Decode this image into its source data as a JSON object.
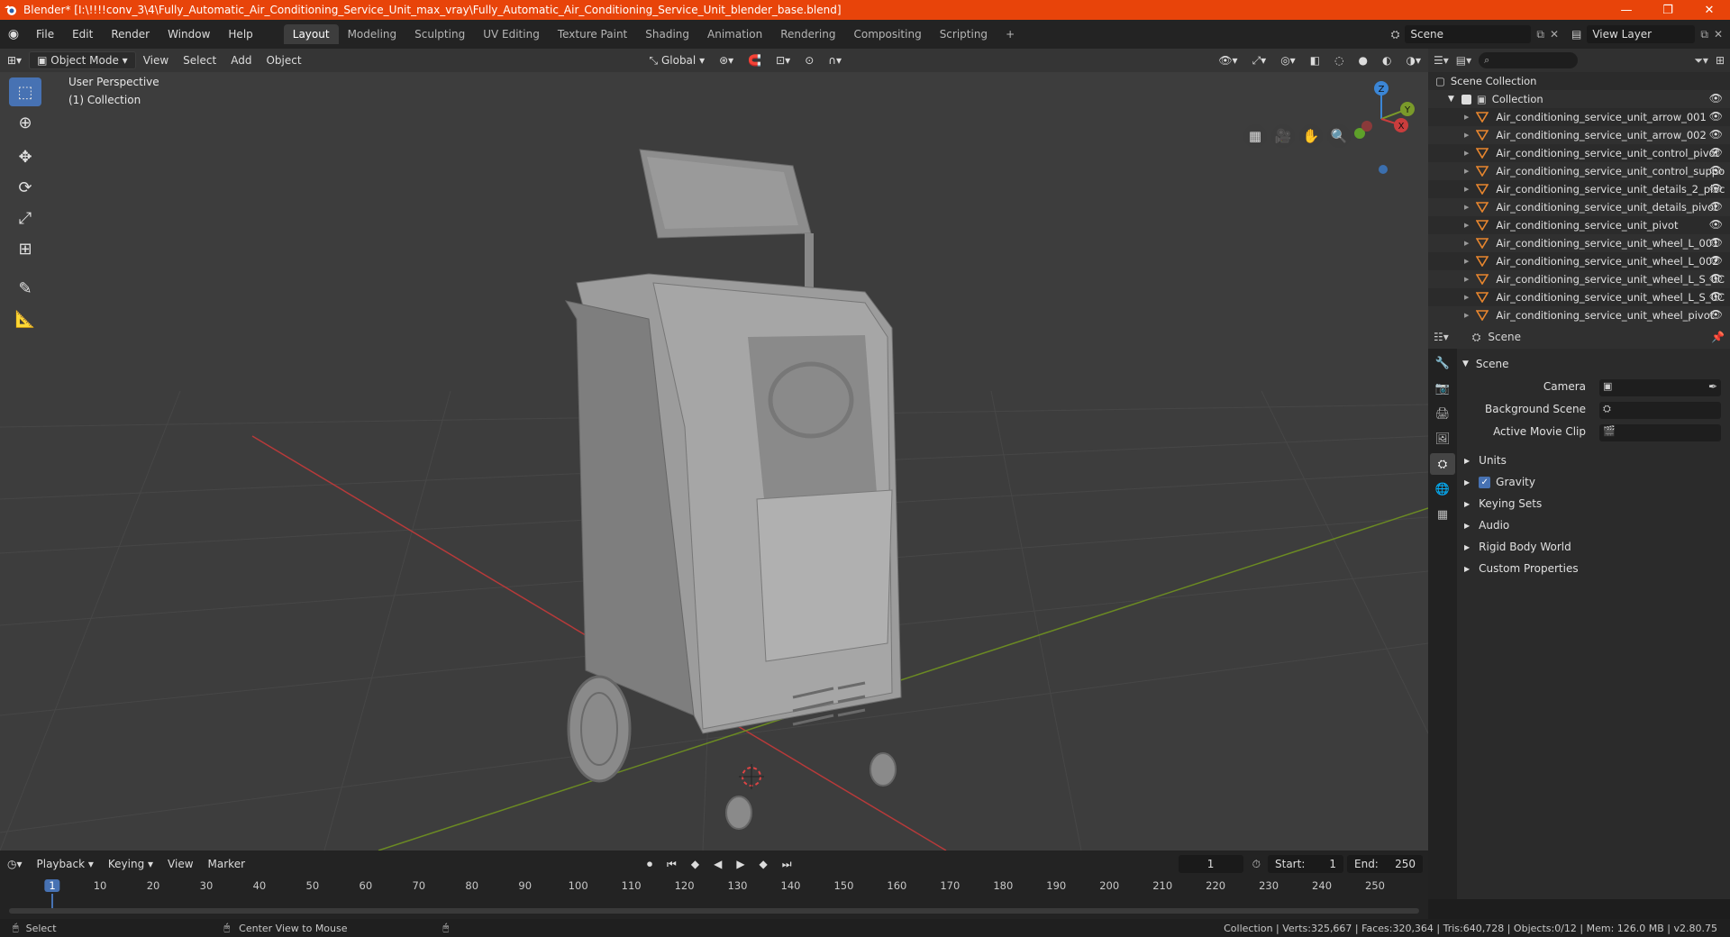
{
  "titlebar": {
    "title": "Blender* [I:\\!!!!conv_3\\4\\Fully_Automatic_Air_Conditioning_Service_Unit_max_vray\\Fully_Automatic_Air_Conditioning_Service_Unit_blender_base.blend]",
    "minimize": "—",
    "restore": "❐",
    "close": "✕"
  },
  "menu": {
    "items": [
      "File",
      "Edit",
      "Render",
      "Window",
      "Help"
    ],
    "workspaces": [
      "Layout",
      "Modeling",
      "Sculpting",
      "UV Editing",
      "Texture Paint",
      "Shading",
      "Animation",
      "Rendering",
      "Compositing",
      "Scripting"
    ],
    "active_workspace": "Layout",
    "add_workspace": "+",
    "scene_label": "Scene",
    "view_layer_label": "View Layer"
  },
  "viewport": {
    "mode": "Object Mode",
    "menus": [
      "View",
      "Select",
      "Add",
      "Object"
    ],
    "transform_orientation": "Global",
    "overlay_line1": "User Perspective",
    "overlay_line2": "(1) Collection",
    "gizmo_axes": {
      "z": "Z",
      "y": "Y",
      "x": "X"
    }
  },
  "outliner": {
    "root": "Scene Collection",
    "collection": "Collection",
    "search_placeholder": "",
    "items": [
      "Air_conditioning_service_unit_arrow_001",
      "Air_conditioning_service_unit_arrow_002",
      "Air_conditioning_service_unit_control_pivot",
      "Air_conditioning_service_unit_control_suppo",
      "Air_conditioning_service_unit_details_2_pivc",
      "Air_conditioning_service_unit_details_pivot",
      "Air_conditioning_service_unit_pivot",
      "Air_conditioning_service_unit_wheel_L_001",
      "Air_conditioning_service_unit_wheel_L_002",
      "Air_conditioning_service_unit_wheel_L_S_0C",
      "Air_conditioning_service_unit_wheel_L_S_0C",
      "Air_conditioning_service_unit_wheel_pivot"
    ]
  },
  "properties": {
    "breadcrumb": "Scene",
    "section": "Scene",
    "fields": [
      {
        "label": "Camera"
      },
      {
        "label": "Background Scene"
      },
      {
        "label": "Active Movie Clip"
      }
    ],
    "subsections": [
      "Units",
      "Gravity",
      "Keying Sets",
      "Audio",
      "Rigid Body World",
      "Custom Properties"
    ],
    "gravity_checked": true
  },
  "timeline": {
    "menus": [
      "Playback",
      "Keying",
      "View",
      "Marker"
    ],
    "current_frame": "1",
    "start_label": "Start:",
    "start_value": "1",
    "end_label": "End:",
    "end_value": "250",
    "ticks": [
      "1",
      "10",
      "20",
      "30",
      "40",
      "50",
      "60",
      "70",
      "80",
      "90",
      "100",
      "110",
      "120",
      "130",
      "140",
      "150",
      "160",
      "170",
      "180",
      "190",
      "200",
      "210",
      "220",
      "230",
      "240",
      "250"
    ]
  },
  "statusbar": {
    "select": "Select",
    "center_view": "Center View to Mouse",
    "stats": "Collection | Verts:325,667 | Faces:320,364 | Tris:640,728 | Objects:0/12 | Mem: 126.0 MB | v2.80.75"
  },
  "colors": {
    "titlebar": "#e8440a",
    "accent": "#4772b3",
    "axis_x": "#c93d3d",
    "axis_y": "#7a9a2a",
    "axis_z": "#3b86d6",
    "object_icon": "#e8862e"
  }
}
